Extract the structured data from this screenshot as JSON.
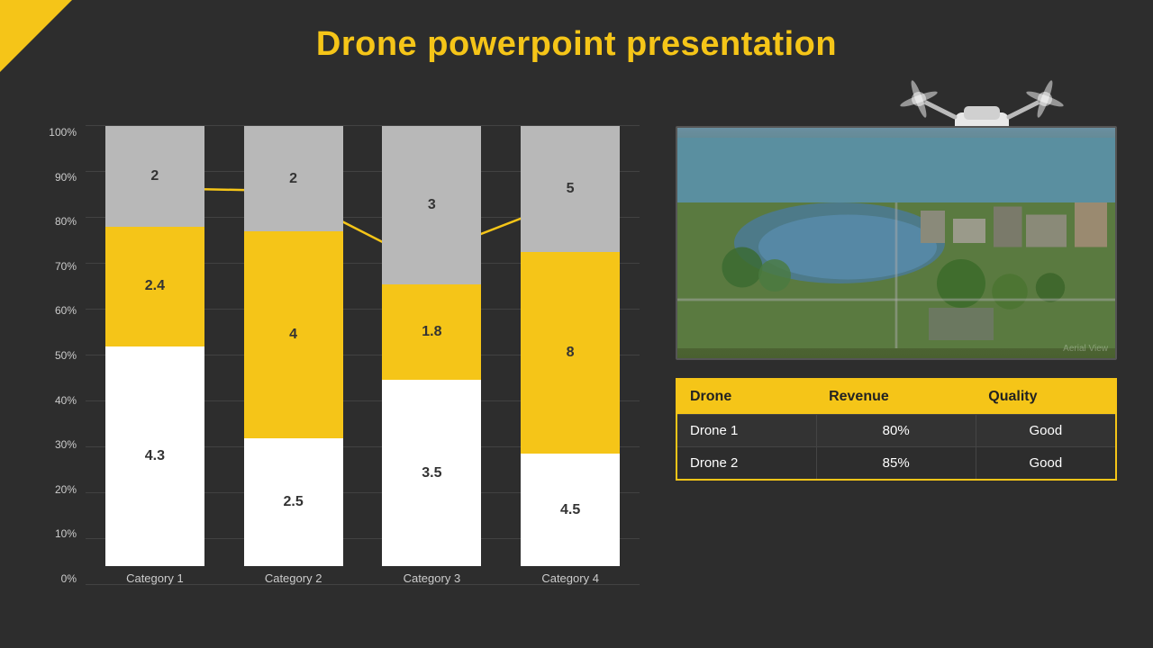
{
  "title": "Drone powerpoint presentation",
  "chart": {
    "y_labels": [
      "0%",
      "10%",
      "20%",
      "30%",
      "40%",
      "50%",
      "60%",
      "70%",
      "80%",
      "90%",
      "100%"
    ],
    "categories": [
      "Category 1",
      "Category 2",
      "Category 3",
      "Category 4"
    ],
    "bars": [
      {
        "category": "Category 1",
        "top_val": "2",
        "top_pct": 23,
        "mid_val": "2.4",
        "mid_pct": 27,
        "bot_val": "4.3",
        "bot_pct": 50
      },
      {
        "category": "Category 2",
        "top_val": "2",
        "top_pct": 29,
        "mid_val": "4",
        "mid_pct": 47,
        "bot_val": "2.5",
        "bot_pct": 29
      },
      {
        "category": "Category 3",
        "top_val": "3",
        "top_pct": 35,
        "mid_val": "1.8",
        "mid_pct": 21,
        "bot_val": "3.5",
        "bot_pct": 41
      },
      {
        "category": "Category 4",
        "top_val": "5",
        "top_pct": 28,
        "mid_val": "8",
        "mid_pct": 45,
        "bot_val": "4.5",
        "bot_pct": 25
      }
    ]
  },
  "table": {
    "headers": [
      "Drone",
      "Revenue",
      "Quality"
    ],
    "rows": [
      [
        "Drone 1",
        "80%",
        "Good"
      ],
      [
        "Drone 2",
        "85%",
        "Good"
      ]
    ]
  }
}
